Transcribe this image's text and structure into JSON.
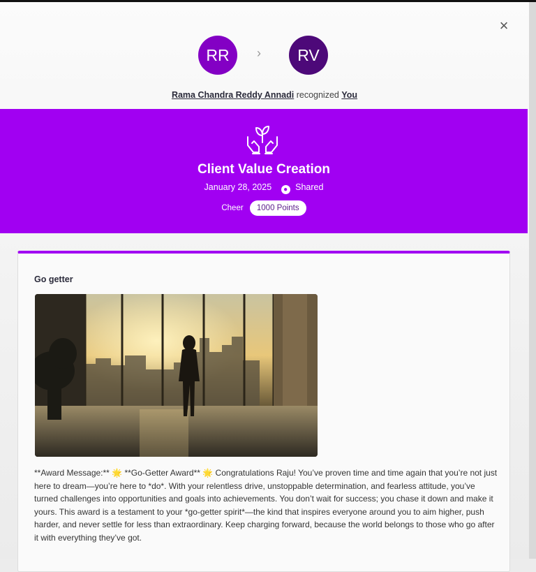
{
  "modal": {
    "close_label": "×"
  },
  "recognition": {
    "from_initials": "RR",
    "to_initials": "RV",
    "from_name": "Rama Chandra Reddy Annadi",
    "verb": "recognized",
    "to_name": "You"
  },
  "award": {
    "title": "Client Value Creation",
    "date": "January 28, 2025",
    "visibility": "Shared",
    "cheer_label": "Cheer",
    "points": "1000 Points",
    "icon": "hands-plant-icon",
    "banner_color": "#a100f2"
  },
  "post": {
    "title": "Go getter",
    "image_alt": "Woman silhouetted against a sunlit window in an office",
    "message": "**Award Message:** 🌟 **Go-Getter Award** 🌟 Congratulations Raju! You’ve proven time and time again that you’re not just here to dream—you’re here to *do*. With your relentless drive, unstoppable determination, and fearless attitude, you’ve turned challenges into opportunities and goals into achievements. You don’t wait for success; you chase it down and make it yours. This award is a testament to your *go-getter spirit*—the kind that inspires everyone around you to aim higher, push harder, and never settle for less than extraordinary. Keep charging forward, because the world belongs to those who go after it with everything they’ve got."
  }
}
